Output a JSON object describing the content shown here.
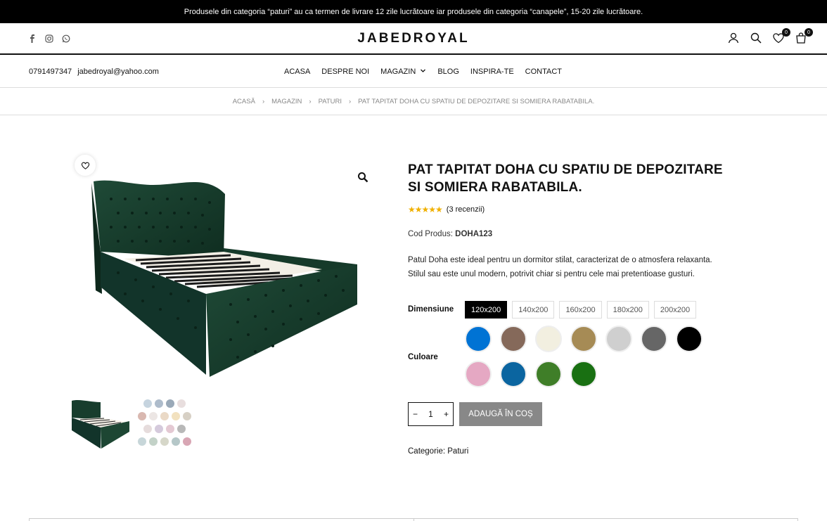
{
  "announcement": "Produsele din categoria “paturi” au ca termen de livrare 12 zile lucrătoare iar produsele din categoria “canapele”, 15-20 zile lucrătoare.",
  "header": {
    "logo": "JABEDROYAL",
    "social": [
      "facebook-icon",
      "instagram-icon",
      "whatsapp-icon"
    ],
    "wishlist_count": "0",
    "cart_count": "0"
  },
  "contact": {
    "phone": "0791497347",
    "email": "jabedroyal@yahoo.com"
  },
  "menu": {
    "home": "ACASA",
    "about": "DESPRE NOI",
    "shop": "MAGAZIN",
    "blog": "BLOG",
    "inspire": "INSPIRA-TE",
    "contact": "CONTACT"
  },
  "breadcrumb": {
    "home": "ACASĂ",
    "shop": "MAGAZIN",
    "category": "PATURI",
    "current": "PAT TAPITAT DOHA CU SPATIU DE DEPOZITARE SI SOMIERA RABATABILA."
  },
  "product": {
    "title": "PAT TAPITAT DOHA CU SPATIU DE DEPOZITARE SI SOMIERA RABATABILA.",
    "rating": 5,
    "reviews": "(3 recenzii)",
    "sku_label": "Cod Produs:",
    "sku": "DOHA123",
    "description": "Patul Doha este ideal pentru un dormitor stilat, caracterizat de o atmosfera relaxanta. Stilul sau este unul modern, potrivit chiar si pentru cele mai pretentioase gusturi.",
    "size_label": "Dimensiune",
    "sizes": [
      "120x200",
      "140x200",
      "160x200",
      "180x200",
      "200x200"
    ],
    "selected_size": "120x200",
    "color_label": "Culoare",
    "colors": [
      "#0073d4",
      "#85695a",
      "#f2efe0",
      "#a68b55",
      "#cfcfcf",
      "#666666",
      "#000000",
      "#e5a8c3",
      "#0b65a0",
      "#3f7e28",
      "#197012"
    ],
    "quantity": "1",
    "add_to_cart": "ADAUGĂ ÎN COȘ",
    "category_label": "Categorie:",
    "category": "Paturi",
    "bed_color": "#173d2d"
  }
}
